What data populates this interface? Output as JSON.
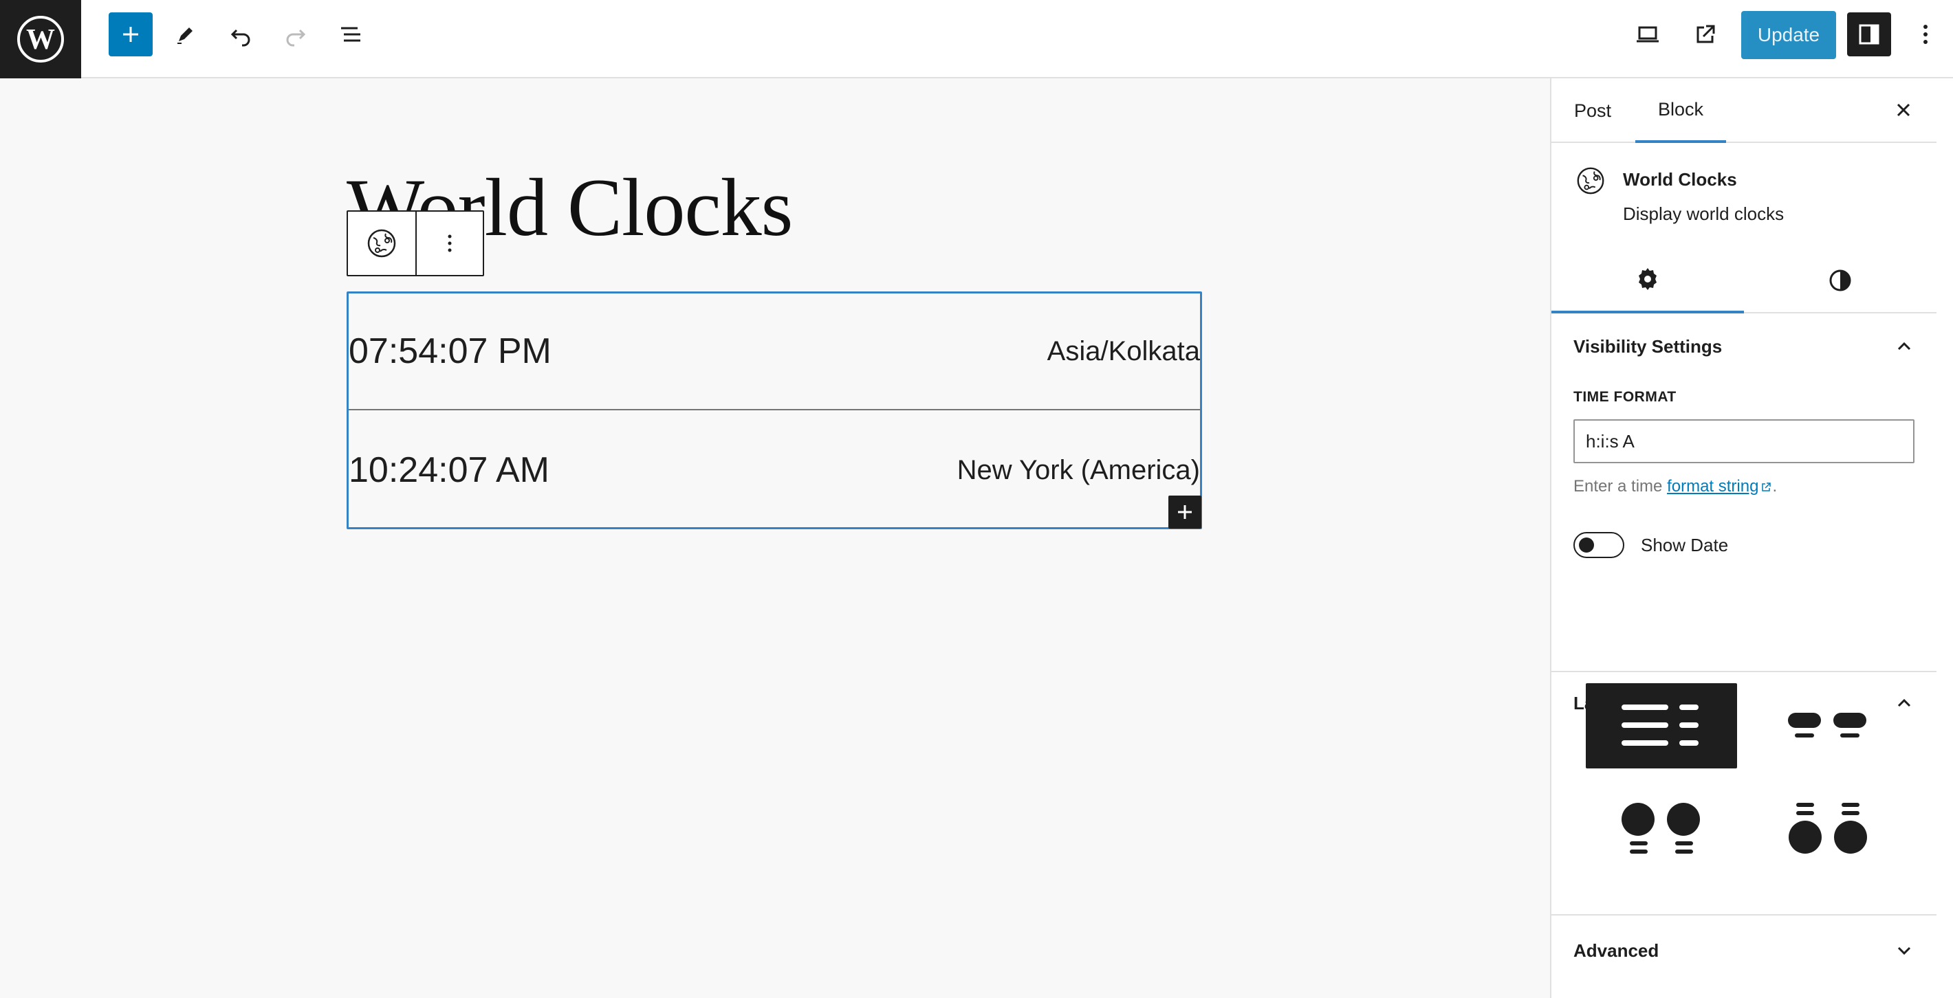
{
  "topbar": {
    "logo_icon": "wordpress-icon",
    "update_label": "Update",
    "icons": [
      "plus-icon",
      "pencil-icon",
      "undo-icon",
      "redo-icon",
      "list-view-icon",
      "desktop-view-icon",
      "external-link-icon",
      "sidebar-toggle-icon",
      "more-vertical-icon"
    ]
  },
  "canvas": {
    "title": "World Clocks",
    "clocks": [
      {
        "time": "07:54:07 PM",
        "zone": "Asia/Kolkata"
      },
      {
        "time": "10:24:07 AM",
        "zone": "New York (America)"
      }
    ]
  },
  "sidebar": {
    "tabs": [
      "Post",
      "Block"
    ],
    "active_tab": "Block",
    "block": {
      "name": "World Clocks",
      "description": "Display world clocks",
      "icon": "globe-icon"
    },
    "sub_tabs": [
      "gear-icon",
      "contrast-icon"
    ],
    "visibility": {
      "heading": "Visibility Settings",
      "time_format_label": "TIME FORMAT",
      "time_format_value": "h:i:s A",
      "help_prefix": "Enter a time ",
      "help_link": "format string",
      "help_suffix": ".",
      "show_date_label": "Show Date",
      "show_date_on": false
    },
    "layout": {
      "heading": "Layout",
      "selected_option": 1
    },
    "advanced": {
      "heading": "Advanced"
    }
  },
  "colors": {
    "accent": "#007cba",
    "dark": "#1e1e1e",
    "focus": "#3582c4"
  }
}
